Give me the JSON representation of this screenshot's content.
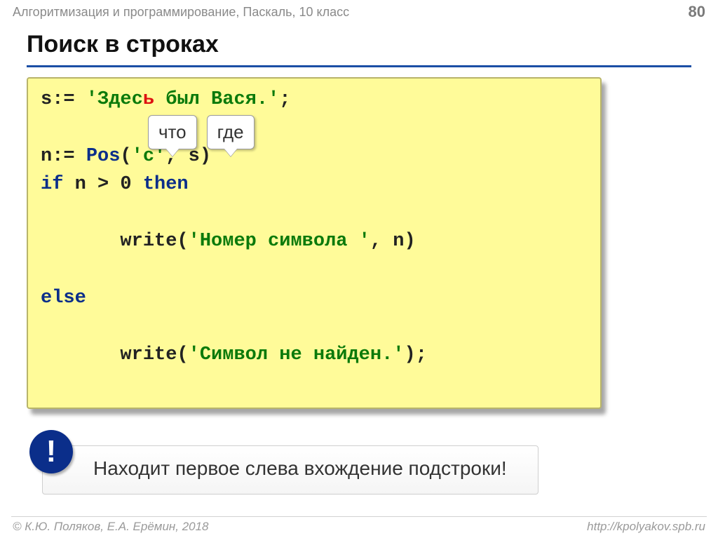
{
  "header": {
    "topic": "Алгоритмизация и программирование, Паскаль, 10 класс",
    "page": "80"
  },
  "title": "Поиск в строках",
  "code": {
    "l1_a": "s:= ",
    "l1_b": "'Здес",
    "l1_c": "ь",
    "l1_d": " был Вася.'",
    "l1_e": ";",
    "l2_a": "n:= ",
    "l2_b": "Pos",
    "l2_c": "(",
    "l2_d": "'с'",
    "l2_e": ", s)",
    "l3_a": "if",
    "l3_b": " n > 0 ",
    "l3_c": "then",
    "l4_a": "   write(",
    "l4_b": "'Номер символа '",
    "l4_c": ", n)",
    "l5_a": "else",
    "l6_a": "   write(",
    "l6_b": "'Символ не найден.'",
    "l6_c": ");"
  },
  "labels": {
    "what": "что",
    "where": "где"
  },
  "note": {
    "badge": "!",
    "text": "Находит первое слева вхождение подстроки!"
  },
  "footer": {
    "copyright": "© К.Ю. Поляков, Е.А. Ерёмин, 2018",
    "url": "http://kpolyakov.spb.ru"
  }
}
